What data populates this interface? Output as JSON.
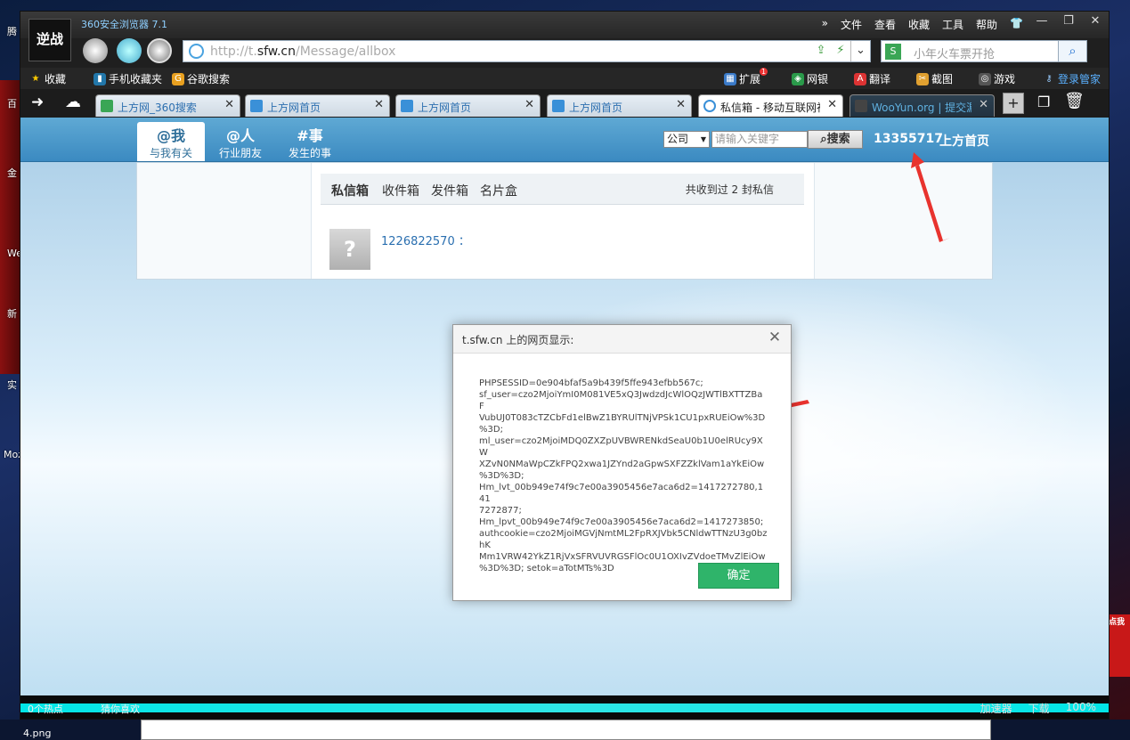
{
  "browser": {
    "app_title": "360安全浏览器 7.1",
    "logo_text": "逆战",
    "menu": [
      "»",
      "文件",
      "查看",
      "收藏",
      "工具",
      "帮助"
    ],
    "address": {
      "prefix": "http://t.",
      "domain": "sfw.cn",
      "path": "/Message/allbox"
    },
    "search_placeholder": "小年火车票开抢",
    "favorites": [
      "收藏",
      "手机收藏夹",
      "谷歌搜索"
    ],
    "toolbar_right": [
      "扩展",
      "网银",
      "翻译",
      "截图",
      "游戏",
      "登录管家"
    ],
    "ext_badge": "1",
    "tabs": [
      "上方网_360搜索",
      "上方网首页",
      "上方网首页",
      "上方网首页",
      "私信箱 - 移动互联网社",
      "WooYun.org | 提交漏洞"
    ]
  },
  "site": {
    "nav": [
      {
        "a": "@我",
        "b": "与我有关"
      },
      {
        "a": "@人",
        "b": "行业朋友"
      },
      {
        "a": "#事",
        "b": "发生的事"
      }
    ],
    "select_value": "公司",
    "search_placeholder": "请输入关键字",
    "search_button": "搜索",
    "user_id": "13355717",
    "home_link": "上方首页",
    "msg_tabs": [
      "私信箱",
      "收件箱",
      "发件箱",
      "名片盒"
    ],
    "msg_count": "共收到过 2 封私信",
    "sender": "1226822570 ："
  },
  "dialog": {
    "title": "t.sfw.cn 上的网页显示:",
    "message": "PHPSESSID=0e904bfaf5a9b439f5ffe943efbb567c;\nsf_user=czo2MjoiYmI0M081VE5xQ3JwdzdJcWlOQzJWTlBXTTZBaF\nVubUJ0T083cTZCbFd1elBwZ1BYRUlTNjVPSk1CU1pxRUEiOw%3D\n%3D;\nml_user=czo2MjoiMDQ0ZXZpUVBWRENkdSeaU0b1U0elRUcy9XW\nXZvN0NMaWpCZkFPQ2xwa1JZYnd2aGpwSXFZZklVam1aYkEiOw\n%3D%3D;\nHm_lvt_00b949e74f9c7e00a3905456e7aca6d2=1417272780,141\n7272877;\nHm_lpvt_00b949e74f9c7e00a3905456e7aca6d2=1417273850;\nauthcookie=czo2MjoiMGVjNmtML2FpRXJVbk5CNldwTTNzU3g0bzhK\nMm1VRW42YkZ1RjVxSFRVUVRGSFlOc0U1OXIvZVdoeTMvZlEiOw\n%3D%3D; setok=aTotMTs%3D",
    "ok_label": "确定"
  },
  "statusbar": {
    "left": [
      "0个热点",
      "猜你喜欢"
    ],
    "right": [
      "加速器",
      "下载",
      "100%"
    ]
  },
  "desktop": {
    "icons": [
      "腾",
      "百",
      "金",
      "We",
      "新",
      "实",
      "Moz"
    ],
    "taskbar_file": "4.png",
    "right_text": "点我"
  },
  "colors": {
    "accent": "#3b8ac1",
    "ok_button": "#2fb46a",
    "arrow": "#e8332e"
  }
}
